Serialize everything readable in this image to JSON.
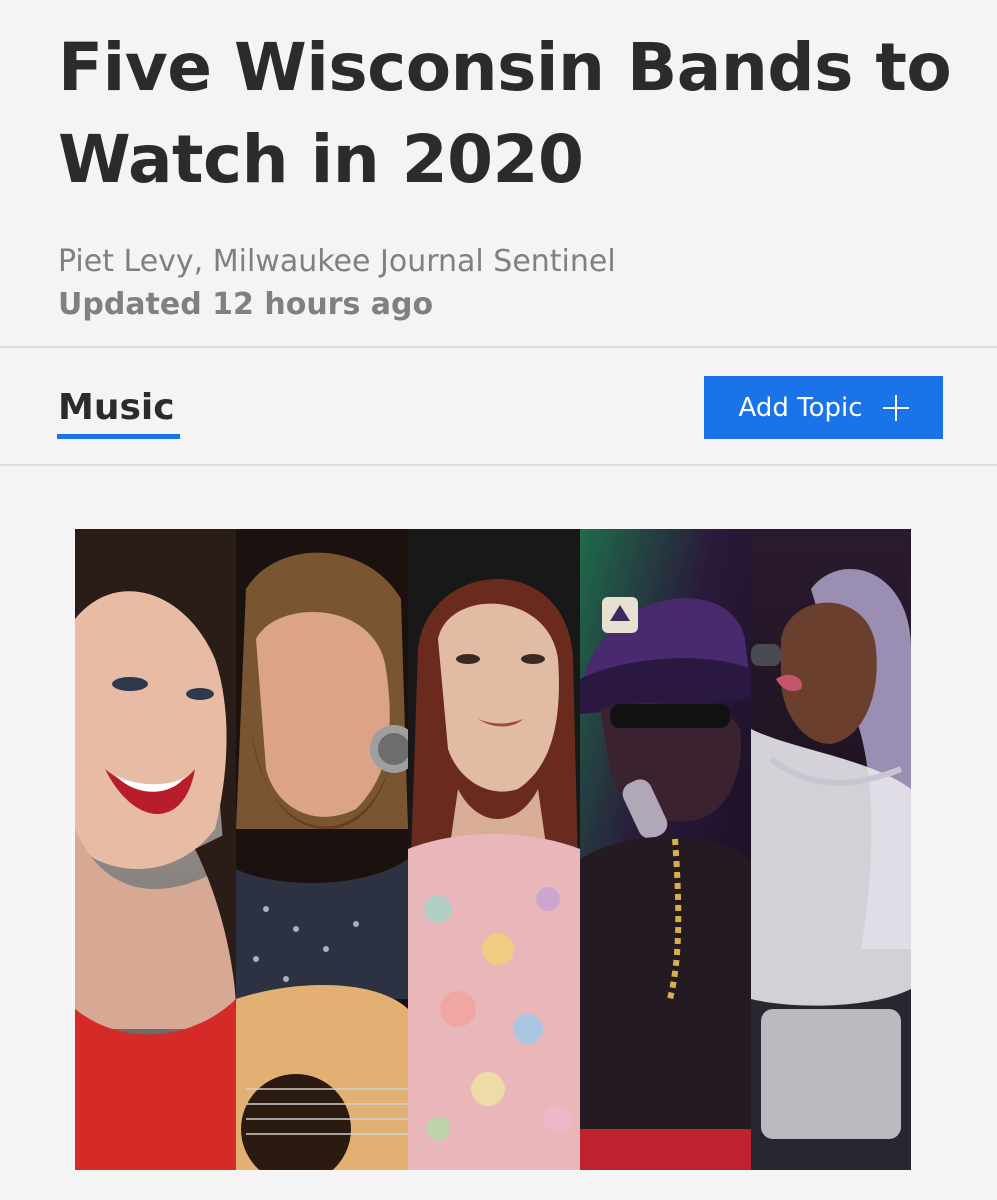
{
  "article": {
    "title": "Five Wisconsin Bands to Watch in 2020",
    "byline": "Piet Levy, Milwaukee Journal Sentinel",
    "updated": "Updated 12 hours ago"
  },
  "topics": {
    "current": "Music",
    "add_label": "Add Topic",
    "add_icon": "plus-icon"
  },
  "colors": {
    "accent": "#1a73e8",
    "title": "#2b2b2b",
    "meta": "#808080"
  },
  "hero_image": {
    "alt": "Collage of five Wisconsin musicians performing"
  }
}
